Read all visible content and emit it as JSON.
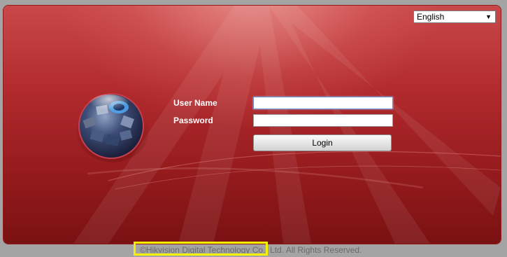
{
  "language_select": {
    "value": "English",
    "arrow_icon": "triangle-down-icon"
  },
  "login_form": {
    "username_label": "User Name",
    "password_label": "Password",
    "username_value": "",
    "password_value": "",
    "login_label": "Login"
  },
  "footer": {
    "copyright": "©Hikvision Digital Technology Co., Ltd. All Rights Reserved."
  },
  "colors": {
    "page_bg": "#a4a4a4",
    "panel_top": "#c9484a",
    "panel_bottom": "#7a1112",
    "highlight": "#f3f000"
  },
  "logo": {
    "icon": "hikvision-globe-logo-icon"
  }
}
